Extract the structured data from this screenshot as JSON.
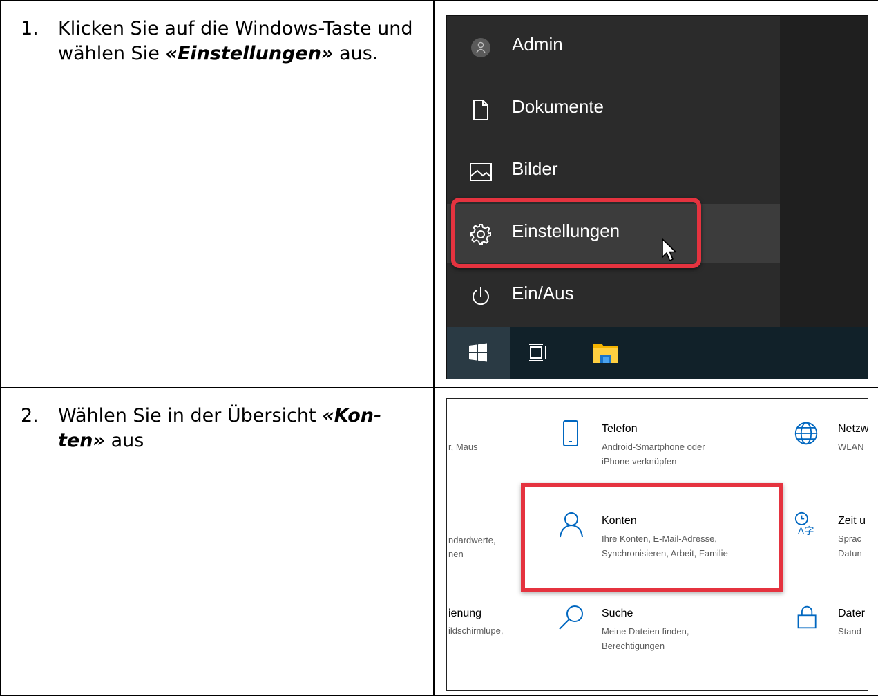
{
  "steps": [
    {
      "number": "1.",
      "text_before": "Klicken Sie auf die Windows-Taste und wählen Sie ",
      "emphasis": "«Einstellungen»",
      "text_after": " aus."
    },
    {
      "number": "2.",
      "text_before": "Wählen Sie in der Übersicht ",
      "emphasis": "«Kon-ten»",
      "text_after": " aus"
    }
  ],
  "start_menu": {
    "items": [
      {
        "label": "Admin",
        "icon": "user-avatar-icon"
      },
      {
        "label": "Dokumente",
        "icon": "document-icon"
      },
      {
        "label": "Bilder",
        "icon": "image-icon"
      },
      {
        "label": "Einstellungen",
        "icon": "gear-icon"
      },
      {
        "label": "Ein/Aus",
        "icon": "power-icon"
      }
    ],
    "taskbar": [
      "windows-logo-icon",
      "task-view-icon",
      "file-explorer-icon"
    ],
    "highlight_color": "#e5333f"
  },
  "settings": {
    "left_partial": {
      "row1_desc": "r, Maus",
      "row2_desc1": "ndardwerte,",
      "row2_desc2": "nen",
      "row3_title": "ienung",
      "row3_desc": "ildschirmlupe,"
    },
    "tiles": [
      {
        "title": "Telefon",
        "desc1": "Android-Smartphone oder",
        "desc2": "iPhone verknüpfen",
        "icon": "phone-icon"
      },
      {
        "title": "Konten",
        "desc1": "Ihre Konten, E-Mail-Adresse,",
        "desc2": "Synchronisieren, Arbeit, Familie",
        "icon": "person-icon"
      },
      {
        "title": "Suche",
        "desc1": "Meine Dateien finden,",
        "desc2": "Berechtigungen",
        "icon": "search-icon"
      }
    ],
    "right_partial": {
      "row1_title": "Netzw",
      "row1_desc": "WLAN",
      "row2_title": "Zeit u",
      "row2_desc1": "Sprac",
      "row2_desc2": "Datun",
      "row3_title": "Dater",
      "row3_desc": "Stand"
    },
    "accent_color": "#0067c0"
  }
}
